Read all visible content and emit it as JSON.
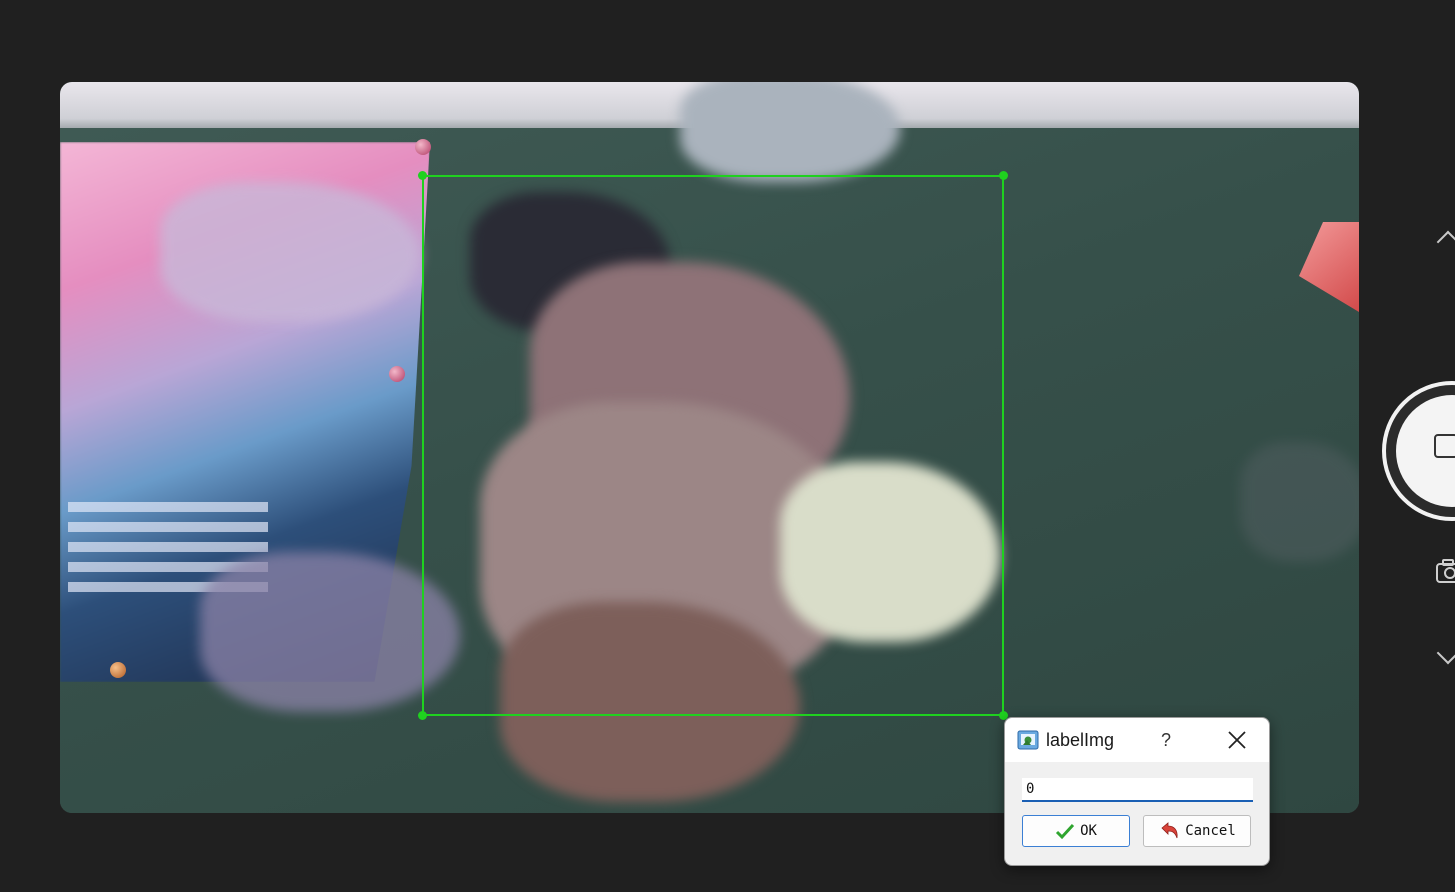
{
  "dialog": {
    "title": "labelImg",
    "help_label": "?",
    "label_input_value": "0",
    "ok_label": "OK",
    "cancel_label": "Cancel"
  },
  "icons": {
    "app": "labelimg-app-icon",
    "help": "help-icon",
    "close": "close-icon",
    "ok": "checkmark-icon",
    "cancel": "undo-arrow-icon",
    "camera": "camera-icon",
    "video_mode": "video-mode-icon",
    "scroll_up": "chevron-up-icon",
    "scroll_down": "chevron-down-icon"
  },
  "colors": {
    "bounding_box": "#1fd11f",
    "background": "#202020",
    "focus_accent": "#1a5fb4"
  }
}
